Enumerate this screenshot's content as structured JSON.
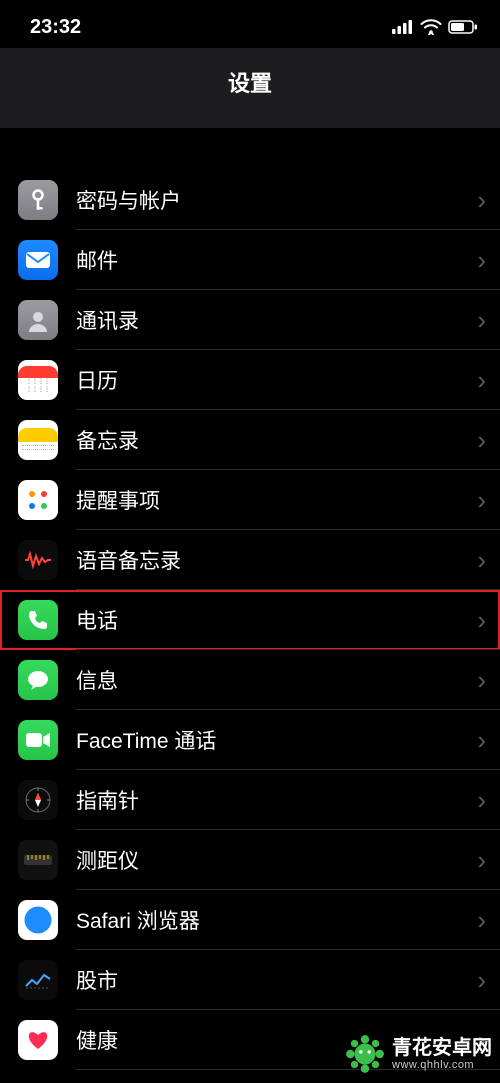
{
  "status": {
    "time": "23:32"
  },
  "header": {
    "title": "设置"
  },
  "rows": [
    {
      "key": "passwords",
      "label": "密码与帐户",
      "highlighted": false
    },
    {
      "key": "mail",
      "label": "邮件",
      "highlighted": false
    },
    {
      "key": "contacts",
      "label": "通讯录",
      "highlighted": false
    },
    {
      "key": "calendar",
      "label": "日历",
      "highlighted": false
    },
    {
      "key": "notes",
      "label": "备忘录",
      "highlighted": false
    },
    {
      "key": "reminders",
      "label": "提醒事项",
      "highlighted": false
    },
    {
      "key": "voicememo",
      "label": "语音备忘录",
      "highlighted": false
    },
    {
      "key": "phone",
      "label": "电话",
      "highlighted": true
    },
    {
      "key": "messages",
      "label": "信息",
      "highlighted": false
    },
    {
      "key": "facetime",
      "label": "FaceTime 通话",
      "highlighted": false
    },
    {
      "key": "compass",
      "label": "指南针",
      "highlighted": false
    },
    {
      "key": "measure",
      "label": "测距仪",
      "highlighted": false
    },
    {
      "key": "safari",
      "label": "Safari 浏览器",
      "highlighted": false
    },
    {
      "key": "stocks",
      "label": "股市",
      "highlighted": false
    },
    {
      "key": "health",
      "label": "健康",
      "highlighted": false
    }
  ],
  "watermark": {
    "brand": "青花安卓网",
    "url": "www.qhhlv.com"
  }
}
